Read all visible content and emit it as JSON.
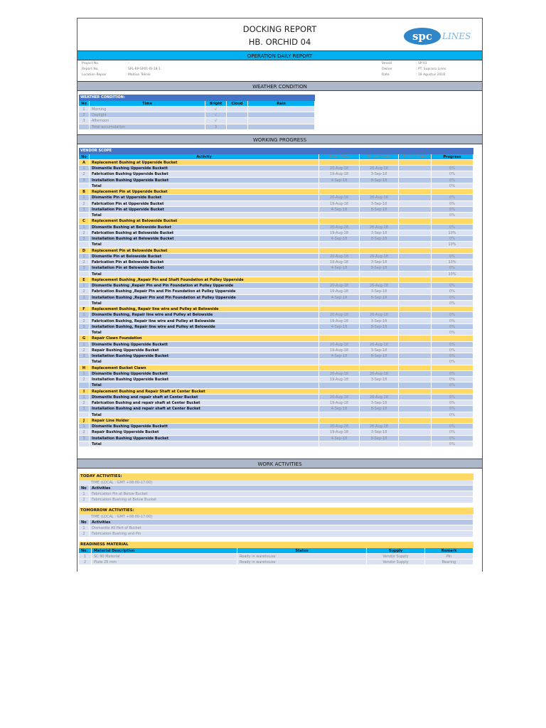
{
  "header": {
    "title": "DOCKING REPORT",
    "subtitle": "HB. ORCHID 04",
    "logo_text": "spc LINES",
    "report_type": "OPERATION DAILY REPORT"
  },
  "info": {
    "left": [
      {
        "label": "Project No.",
        "value": ": -"
      },
      {
        "label": "Report No.",
        "value": ": SPL-RP-SP01-IV-18-1"
      },
      {
        "label": "Location Repair",
        "value": ": Madiun Teknik"
      }
    ],
    "right": [
      {
        "label": "Vessel",
        "value": ": SP 01"
      },
      {
        "label": "Owner",
        "value": ": PT. Supraco Lines"
      },
      {
        "label": "Date",
        "value": ": 19 Agustus 2018"
      }
    ]
  },
  "weather": {
    "section_title": "WEATHER CONDITION",
    "table_title": "WEATHER CONDITION:",
    "columns": [
      "No",
      "Time",
      "Bright",
      "Cloud",
      "Rain"
    ],
    "rows": [
      [
        "1",
        "Morning",
        "√",
        "",
        ""
      ],
      [
        "2",
        "Daylight",
        "√",
        "",
        ""
      ],
      [
        "3",
        "Afternoon",
        "√",
        "",
        ""
      ],
      [
        "",
        "Total accumulation",
        "3",
        "",
        ""
      ]
    ]
  },
  "progress": {
    "section_title": "WORKING PROGRESS",
    "table_title": "VENDOR SCOPE",
    "columns": [
      "No",
      "Activity",
      "Start Date",
      "Target Date",
      "Finish Date",
      "Progress"
    ],
    "groups": [
      {
        "id": "A",
        "title": "Replacement Bushing at Upperside Bucket",
        "items": [
          [
            "1",
            "Dismantle Bushing Upperside Buckett",
            "20-Aug-18",
            "26-Aug-18",
            "",
            "0%"
          ],
          [
            "2",
            "Fabrication Bushing Upperside Bucket",
            "19-Aug-18",
            "3-Sep-18",
            "",
            "0%"
          ],
          [
            "3",
            "Installation Bushing Upperside Bucket",
            "4-Sep-18",
            "8-Sep-18",
            "",
            "0%"
          ]
        ],
        "total": "0%"
      },
      {
        "id": "B",
        "title": "Replacement Pin at Upperside Bucket",
        "items": [
          [
            "1",
            "Dismantle Pin at Upperside Bucket",
            "20-Aug-18",
            "26-Aug-18",
            "",
            "0%"
          ],
          [
            "2",
            "Fabrication Pin at Upperside Bucket",
            "19-Aug-18",
            "3-Sep-18",
            "",
            "0%"
          ],
          [
            "3",
            "Installation Pin at Upperside Bucket",
            "4-Sep-18",
            "8-Sep-18",
            "",
            "0%"
          ]
        ],
        "total": "0%"
      },
      {
        "id": "C",
        "title": "Replacement Bushing at Belowside Bucket",
        "items": [
          [
            "1",
            "Dismantle Bushing at Belowside Bucket",
            "20-Aug-18",
            "26-Aug-18",
            "",
            "0%"
          ],
          [
            "2",
            "Fabrication Bushing at Belowside Bucket",
            "19-Aug-18",
            "3-Sep-18",
            "",
            "10%"
          ],
          [
            "3",
            "Installation Bushing at Belowside Bucket",
            "4-Sep-18",
            "8-Sep-18",
            "",
            "0%"
          ]
        ],
        "total": "10%"
      },
      {
        "id": "D",
        "title": "Replacement Pin at Belowside Bucket",
        "items": [
          [
            "1",
            "Dismantle Pin at Belowside Bucket",
            "20-Aug-18",
            "26-Aug-18",
            "",
            "0%"
          ],
          [
            "2",
            "Fabrication Pin at Belowside Bucket",
            "19-Aug-18",
            "3-Sep-18",
            "",
            "10%"
          ],
          [
            "3",
            "Installation Pin at Belowside Bucket",
            "4-Sep-18",
            "8-Sep-18",
            "",
            "0%"
          ]
        ],
        "total": "10%"
      },
      {
        "id": "E",
        "title": "Replacement Bushing  ,Repair Pin and Shaft Foundation at Pulley Upperside",
        "items": [
          [
            "1",
            "Dismantle Bushing  ,Repair Pin and Pin Foundation at Pulley Upperside",
            "20-Aug-18",
            "26-Aug-18",
            "",
            "0%"
          ],
          [
            "2",
            "Fabrication Bushing  ,Repair Pin and Pin Foundation at Pulley Upperside",
            "19-Aug-18",
            "3-Sep-18",
            "",
            "0%"
          ],
          [
            "3",
            "Installation Bushing  ,Repair Pin and Pin Foundation at Pulley Upperside",
            "4-Sep-18",
            "8-Sep-18",
            "",
            "0%"
          ]
        ],
        "total": "0%"
      },
      {
        "id": "F",
        "title": "Replacement Bushing, Repair line wire and Pulley at Belowside",
        "items": [
          [
            "1",
            "Dismantle Bushing, Repair line wire and Pulley at Belowside",
            "20-Aug-18",
            "26-Aug-18",
            "",
            "0%"
          ],
          [
            "2",
            "Fabrication Bushing, Repair line wire and Pulley at Belowside",
            "19-Aug-18",
            "3-Sep-18",
            "",
            "0%"
          ],
          [
            "3",
            "Installation Bushing, Repair line wire and Pulley at Belowside",
            "4-Sep-18",
            "8-Sep-18",
            "",
            "0%"
          ]
        ],
        "total": "0%"
      },
      {
        "id": "G",
        "title": "Repair Clawn Foundation",
        "items": [
          [
            "1",
            "Dismantle Bushing Upperside Buckett",
            "20-Aug-18",
            "26-Aug-18",
            "",
            "0%"
          ],
          [
            "2",
            "Repair Bushing Upperside Bucket",
            "19-Aug-18",
            "3-Sep-18",
            "",
            "0%"
          ],
          [
            "3",
            "Installation Bushing Upperside Bucket",
            "4-Sep-18",
            "8-Sep-18",
            "",
            "0%"
          ]
        ],
        "total": "0%"
      },
      {
        "id": "H",
        "title": "Replacement Bucket Clawn",
        "items": [
          [
            "1",
            "Dismantle Bushing Upperside Buckett",
            "20-Aug-18",
            "26-Aug-18",
            "",
            "0%"
          ],
          [
            "2",
            "Installation Bushing Upperside Bucket",
            "19-Aug-18",
            "3-Sep-18",
            "",
            "0%"
          ]
        ],
        "total": "0%"
      },
      {
        "id": "I",
        "title": "Replacement  Bushing and Repair Shaft at Center Bucket",
        "items": [
          [
            "1",
            "Dismantle Bushing and repair shaft at Center Bucket",
            "20-Aug-18",
            "26-Aug-18",
            "",
            "0%"
          ],
          [
            "2",
            "Fabrication Bushing and repair shaft at Center Bucket",
            "19-Aug-18",
            "3-Sep-18",
            "",
            "0%"
          ],
          [
            "3",
            "Installation Bushing and repair shaft at Center Bucket",
            "4-Sep-18",
            "8-Sep-18",
            "",
            "0%"
          ]
        ],
        "total": "0%"
      },
      {
        "id": "J",
        "title": "Repair Line Holder",
        "items": [
          [
            "1",
            "Dismantle Bushing Upperside Buckett",
            "20-Aug-18",
            "26-Aug-18",
            "",
            "0%"
          ],
          [
            "2",
            "Repair Bushing Upperside Bucket",
            "19-Aug-18",
            "3-Sep-18",
            "",
            "0%"
          ],
          [
            "3",
            "Installation Bushing Upperside Bucket",
            "4-Sep-18",
            "8-Sep-18",
            "",
            "0%"
          ]
        ],
        "total": "0%"
      }
    ],
    "total_label": "Total"
  },
  "activities": {
    "section_title": "WORK ACTIVITIES",
    "today": {
      "title": "TODAY ACTIVITIES:",
      "time": "TIME (LOCAL : GMT +08:00-17:00)",
      "col_no": "No",
      "col_act": "Activities",
      "rows": [
        [
          "1",
          "Fabrication Pin at Below Bucket"
        ],
        [
          "2",
          "Fabrication Bushing at Below Bucket"
        ]
      ]
    },
    "tomorrow": {
      "title": "TOMORROW ACTIVITIES:",
      "time": "TIME (LOCAL : GMT +08:00-17:00)",
      "col_no": "No",
      "col_act": "Activities",
      "rows": [
        [
          "1",
          "Dismantle All Part of Bucket"
        ],
        [
          "2",
          "Fabrication Bushing and Pin"
        ]
      ]
    },
    "material": {
      "title": "READINESS MATERIAL",
      "columns": [
        "No.",
        "Material Description",
        "Status",
        "Supply",
        "Remark"
      ],
      "rows": [
        [
          "1",
          "SC 90 Material",
          "Ready in warehouse",
          "Vendor Supply",
          "Pin"
        ],
        [
          "2",
          "Plate 25 mm",
          "Ready in warehouse",
          "Vendor Supply",
          "Bearing"
        ]
      ]
    }
  },
  "colors": {
    "cyan": "#00b0f0",
    "blue": "#4472c4",
    "yellow": "#ffd966",
    "row_dark": "#b4c6e7",
    "row_light": "#d9e1f2",
    "section_gray": "#adb9ca"
  }
}
